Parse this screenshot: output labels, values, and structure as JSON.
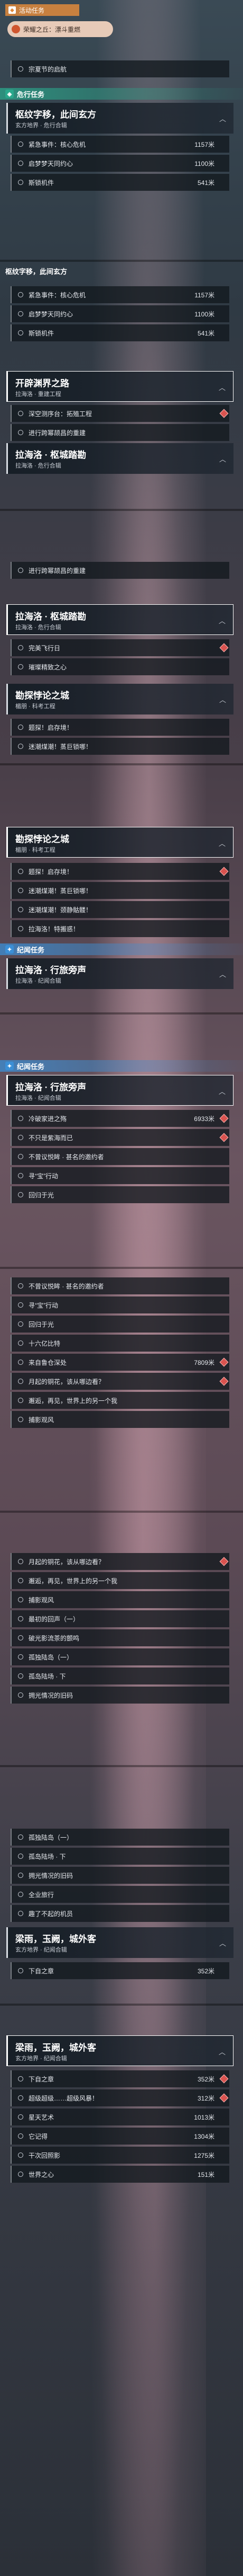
{
  "top": {
    "pill": "活动任务",
    "active_quest": "荣耀之丘：漂斗重燃",
    "event_row": "宗夏节的启航"
  },
  "sec_common": "危行任务",
  "sec_side": "纪闻任务",
  "quests": {
    "a": {
      "title": "枢纹字移，此间玄方",
      "sub": "玄方地界 · 危行合辑"
    },
    "b": {
      "title": "开辟渊界之路",
      "sub": "拉海洛 · 重建工程"
    },
    "c": {
      "title": "拉海洛 · 枢城踏勘",
      "sub": "拉海洛 · 危行合辑"
    },
    "d": {
      "title": "勘探悖论之城",
      "sub": "楣朋 · 科考工程"
    },
    "e": {
      "title": "拉海洛 · 行旅旁声",
      "sub": "拉海洛 · 纪闻合辑"
    },
    "f": {
      "title": "梁雨，玉阙，城外客",
      "sub": "玄方地界 · 纪闻合辑"
    }
  },
  "rows": {
    "r1": {
      "label": "紧急事件：核心危机",
      "dist": "1157米"
    },
    "r2": {
      "label": "启梦梦天同约心",
      "dist": "1100米"
    },
    "r3": {
      "label": "斯锁机件",
      "dist": "541米"
    },
    "r4": {
      "label": "深空测序台：拓殖工程",
      "dist": ""
    },
    "r5": {
      "label": "进行跨幂颉昌的重建",
      "dist": ""
    },
    "r6": {
      "label": "完美飞行日",
      "dist": ""
    },
    "r7": {
      "label": "璀璨精致之心",
      "dist": ""
    },
    "r8": {
      "label": "题探！启存境！",
      "dist": ""
    },
    "r9": {
      "label": "迷潮煤潮！蒸巨锁哪！",
      "dist": ""
    },
    "r10": {
      "label": "迷潮煤潮！颈静骷髅！",
      "dist": ""
    },
    "r11": {
      "label": "拉海洛！特搬惑！",
      "dist": ""
    },
    "r12": {
      "label": "冷破家进之殇",
      "dist": "6933米"
    },
    "r13": {
      "label": "不只是紫海而已",
      "dist": ""
    },
    "r14": {
      "label": "不曾议悦眸 · 甚名的邀约者",
      "dist": ""
    },
    "r15": {
      "label": "寻“宝”行动",
      "dist": ""
    },
    "r16": {
      "label": "回归于光",
      "dist": ""
    },
    "r17": {
      "label": "十六亿比特",
      "dist": ""
    },
    "r18": {
      "label": "来自鲁仓深处",
      "dist": "7809米"
    },
    "r19": {
      "label": "月起的铜花，该从哪边看？",
      "dist": ""
    },
    "r20": {
      "label": "邂逅，再见，世界上的另一个我",
      "dist": ""
    },
    "r21": {
      "label": "捕影观风",
      "dist": ""
    },
    "r22": {
      "label": "最初的回声（一）",
      "dist": ""
    },
    "r23": {
      "label": "破光影流茶的颤鸣",
      "dist": ""
    },
    "r24": {
      "label": "孤独陆岛（一）",
      "dist": ""
    },
    "r25": {
      "label": "孤岛陆场 · 下",
      "dist": ""
    },
    "r26": {
      "label": "拥光情况的旧码",
      "dist": ""
    },
    "r27": {
      "label": "全业旅行",
      "dist": ""
    },
    "r28": {
      "label": "趣了不起的机员",
      "dist": ""
    },
    "r29": {
      "label": "下自之章",
      "dist": "352米"
    },
    "r30": {
      "label": "超级超级……超级风暴！",
      "dist": "312米"
    },
    "r31": {
      "label": "星天艺术",
      "dist": "1013米"
    },
    "r32": {
      "label": "它记得",
      "dist": "1304米"
    },
    "r33": {
      "label": "干次回照影",
      "dist": "1275米"
    },
    "r34": {
      "label": "世界之心",
      "dist": "151米"
    }
  },
  "icons": {
    "chevron": "chevron-up-icon",
    "tracker": "diamond-tracker-icon"
  },
  "colors": {
    "orange": "#e08a3c",
    "teal": "#2aa88c",
    "blue": "#3b8fd6",
    "tracker": "#d9534f"
  }
}
